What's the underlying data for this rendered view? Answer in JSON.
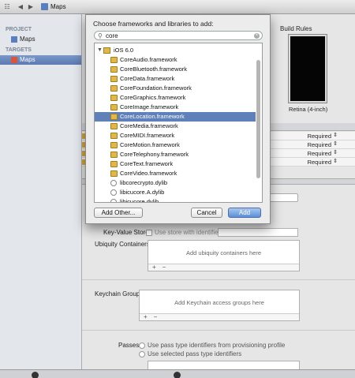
{
  "jumpbar": {
    "nav_grid": "☷",
    "nav_back": "◀",
    "nav_forward": "▶",
    "breadcrumb": "Maps"
  },
  "outline": {
    "project_header": "PROJECT",
    "project_item": "Maps",
    "targets_header": "TARGETS",
    "target_item": "Maps"
  },
  "editor": {
    "build_rules": "Build Rules",
    "retina_label": "Retina (4-inch)",
    "required_rows": [
      "Required",
      "Required",
      "Required",
      "Required"
    ],
    "keyvalue_label": "Key-Value Store",
    "keyvalue_checkbox": "Use store with identifier",
    "ubiquity_label": "Ubiquity Containers",
    "ubiquity_placeholder": "Add ubiquity containers here",
    "keychain_label": "Keychain Groups",
    "keychain_placeholder": "Add Keychain access groups here",
    "passes_label": "Passes",
    "passes_option_1": "Use pass type identifiers from provisioning profile",
    "passes_option_2": "Use selected pass type identifiers",
    "add_glyph": "+",
    "remove_glyph": "−"
  },
  "sheet": {
    "title": "Choose frameworks and libraries to add:",
    "search_value": "core",
    "group_label": "iOS 6.0",
    "items": [
      {
        "label": "CoreAudio.framework",
        "kind": "framework",
        "selected": false
      },
      {
        "label": "CoreBluetooth.framework",
        "kind": "framework",
        "selected": false
      },
      {
        "label": "CoreData.framework",
        "kind": "framework",
        "selected": false
      },
      {
        "label": "CoreFoundation.framework",
        "kind": "framework",
        "selected": false
      },
      {
        "label": "CoreGraphics.framework",
        "kind": "framework",
        "selected": false
      },
      {
        "label": "CoreImage.framework",
        "kind": "framework",
        "selected": false
      },
      {
        "label": "CoreLocation.framework",
        "kind": "framework",
        "selected": true
      },
      {
        "label": "CoreMedia.framework",
        "kind": "framework",
        "selected": false
      },
      {
        "label": "CoreMIDI.framework",
        "kind": "framework",
        "selected": false
      },
      {
        "label": "CoreMotion.framework",
        "kind": "framework",
        "selected": false
      },
      {
        "label": "CoreTelephony.framework",
        "kind": "framework",
        "selected": false
      },
      {
        "label": "CoreText.framework",
        "kind": "framework",
        "selected": false
      },
      {
        "label": "CoreVideo.framework",
        "kind": "framework",
        "selected": false
      },
      {
        "label": "libcorecrypto.dylib",
        "kind": "library",
        "selected": false
      },
      {
        "label": "libicucore.A.dylib",
        "kind": "library",
        "selected": false
      },
      {
        "label": "libicucore.dylib",
        "kind": "library",
        "selected": false
      }
    ],
    "add_other_button": "Add Other...",
    "cancel_button": "Cancel",
    "add_button": "Add"
  },
  "colors": {
    "selection": "#5f80b8",
    "default_button": "#5a8fd8",
    "framework_icon": "#e0b84a"
  }
}
